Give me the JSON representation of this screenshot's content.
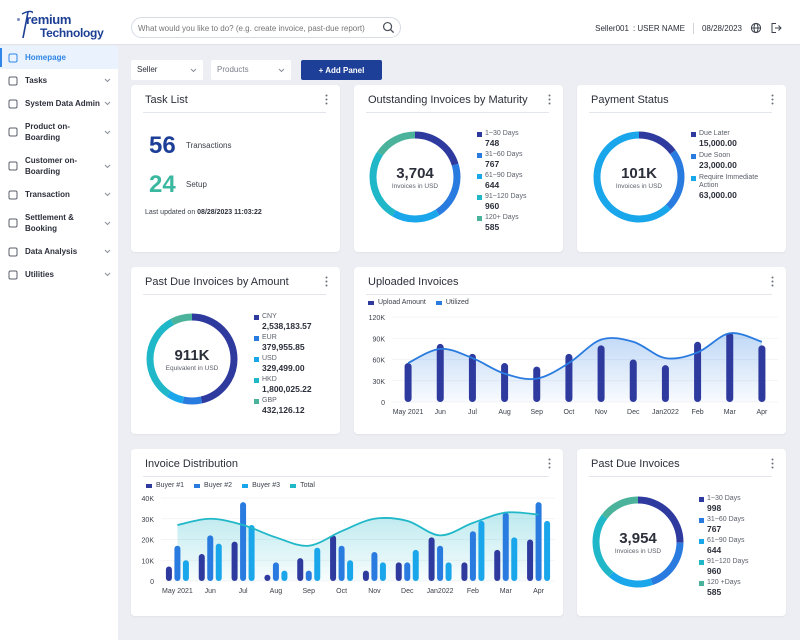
{
  "header": {
    "logo_line1": "remium",
    "logo_line2": "Technology",
    "search_placeholder": "What would you like to do? (e.g. create invoice, past-due report)",
    "user_id": "Seller001",
    "user_name": ": USER NAME",
    "date": "08/28/2023",
    "icons": [
      "search-icon",
      "globe-icon",
      "logout-icon"
    ]
  },
  "sidebar": {
    "items": [
      {
        "label": "Homepage",
        "icon": "home-icon",
        "active": true
      },
      {
        "label": "Tasks",
        "icon": "task-icon"
      },
      {
        "label": "System Data Admin",
        "icon": "admin-icon"
      },
      {
        "label": "Product on-Boarding",
        "icon": "product-icon"
      },
      {
        "label": "Customer on-Boarding",
        "icon": "customer-icon"
      },
      {
        "label": "Transaction",
        "icon": "transaction-icon"
      },
      {
        "label": "Settlement & Booking",
        "icon": "settlement-icon"
      },
      {
        "label": "Data Analysis",
        "icon": "analysis-icon"
      },
      {
        "label": "Utilities",
        "icon": "utilities-icon"
      }
    ]
  },
  "controls": {
    "seller": "Seller",
    "products": "Products",
    "add_panel": "+ Add Panel"
  },
  "colors": {
    "c1": "#2e3a9e",
    "c2": "#2a7be0",
    "c3": "#1aa6ea",
    "c4": "#20b8c8",
    "c5": "#4bb39b",
    "navy": "#1d3f97",
    "teal": "#3bb8a0"
  },
  "task_list": {
    "title": "Task List",
    "transactions_count": "56",
    "transactions_label": "Transactions",
    "setup_count": "24",
    "setup_label": "Setup",
    "updated_prefix": "Last updated on ",
    "updated_value": "08/28/2023 11:03:22"
  },
  "outstanding": {
    "title": "Outstanding Invoices by Maturity",
    "center_value": "3,704",
    "center_label": "Invoices in USD",
    "items": [
      {
        "label": "1~30 Days",
        "value": "748",
        "num": 748
      },
      {
        "label": "31~60 Days",
        "value": "767",
        "num": 767
      },
      {
        "label": "61~90 Days",
        "value": "644",
        "num": 644
      },
      {
        "label": "91~120 Days",
        "value": "960",
        "num": 960
      },
      {
        "label": "120+ Days",
        "value": "585",
        "num": 585
      }
    ]
  },
  "payment_status": {
    "title": "Payment Status",
    "center_value": "101K",
    "center_label": "Invoices in USD",
    "items": [
      {
        "label": "Due Later",
        "value": "15,000.00",
        "num": 15000
      },
      {
        "label": "Due Soon",
        "value": "23,000.00",
        "num": 23000
      },
      {
        "label": "Require Immediate Action",
        "value": "63,000.00",
        "num": 63000
      }
    ]
  },
  "past_due_amount": {
    "title": "Past Due Invoices by Amount",
    "center_value": "911K",
    "center_label": "Equivalent in USD",
    "items": [
      {
        "label": "CNY",
        "value": "2,538,183.57",
        "num": 2538183.57
      },
      {
        "label": "EUR",
        "value": "379,955.85",
        "num": 379955.85
      },
      {
        "label": "USD",
        "value": "329,499.00",
        "num": 329499
      },
      {
        "label": "HKD",
        "value": "1,800,025.22",
        "num": 1800025.22
      },
      {
        "label": "GBP",
        "value": "432,126.12",
        "num": 432126.12
      }
    ]
  },
  "past_due": {
    "title": "Past Due Invoices",
    "center_value": "3,954",
    "center_label": "Invoices in USD",
    "items": [
      {
        "label": "1~30 Days",
        "value": "998",
        "num": 998
      },
      {
        "label": "31~60 Days",
        "value": "767",
        "num": 767
      },
      {
        "label": "61~90 Days",
        "value": "644",
        "num": 644
      },
      {
        "label": "91~120 Days",
        "value": "960",
        "num": 960
      },
      {
        "label": "120 +Days",
        "value": "585",
        "num": 585
      }
    ]
  },
  "chart_data": [
    {
      "type": "bar",
      "title": "Uploaded Invoices",
      "categories": [
        "May 2021",
        "Jun",
        "Jul",
        "Aug",
        "Sep",
        "Oct",
        "Nov",
        "Dec",
        "Jan2022",
        "Feb",
        "Mar",
        "Apr"
      ],
      "series": [
        {
          "name": "Upload  Amount",
          "kind": "bar",
          "values": [
            55000,
            82000,
            68000,
            55000,
            50000,
            68000,
            80000,
            60000,
            52000,
            85000,
            98000,
            80000
          ]
        },
        {
          "name": "Utilized",
          "kind": "area",
          "values": [
            55000,
            75000,
            62000,
            40000,
            33000,
            55000,
            88000,
            85000,
            62000,
            70000,
            97000,
            85000
          ]
        }
      ],
      "yticks": [
        "0",
        "30K",
        "60K",
        "90K",
        "120K"
      ],
      "ylim": [
        0,
        120000
      ],
      "legend": "top-left",
      "grid": true
    },
    {
      "type": "bar",
      "title": "Invoice Distribution",
      "categories": [
        "May 2021",
        "Jun",
        "Jul",
        "Aug",
        "Sep",
        "Oct",
        "Nov",
        "Dec",
        "Jan2022",
        "Feb",
        "Mar",
        "Apr"
      ],
      "series": [
        {
          "name": "Buyer #1",
          "kind": "bar",
          "values": [
            7000,
            13000,
            19000,
            3000,
            11000,
            22000,
            5000,
            9000,
            21000,
            9000,
            15000,
            20000
          ]
        },
        {
          "name": "Buyer #2",
          "kind": "bar",
          "values": [
            17000,
            22000,
            38000,
            9000,
            5000,
            17000,
            14000,
            9000,
            17000,
            24000,
            33000,
            38000
          ]
        },
        {
          "name": "Buyer #3",
          "kind": "bar",
          "values": [
            10000,
            18000,
            27000,
            5000,
            16000,
            10000,
            9000,
            15000,
            9000,
            29000,
            21000,
            29000
          ]
        },
        {
          "name": "Total",
          "kind": "area",
          "values": [
            27000,
            30000,
            27000,
            21000,
            17000,
            24000,
            30000,
            29000,
            22000,
            28000,
            33000,
            32000
          ]
        }
      ],
      "yticks": [
        "0",
        "10K",
        "20K",
        "30K",
        "40K"
      ],
      "ylim": [
        0,
        40000
      ],
      "legend": "top-left",
      "grid": true
    }
  ]
}
